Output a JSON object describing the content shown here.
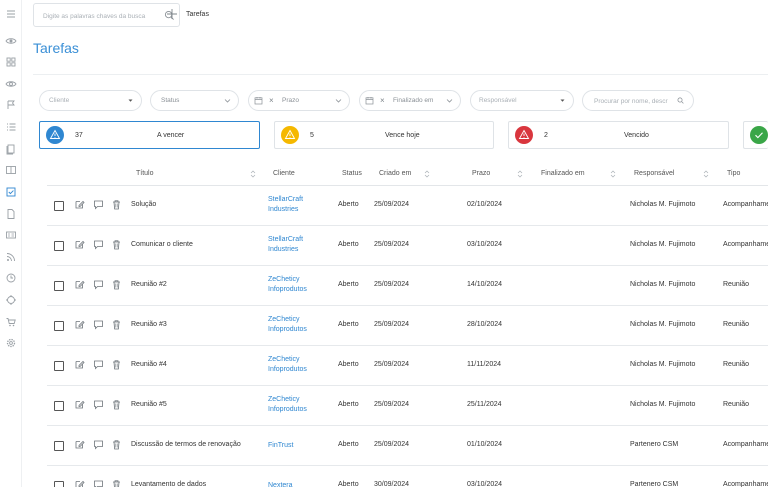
{
  "topbar": {
    "search_placeholder": "Digite as palavras chaves da busca",
    "breadcrumb": "Tarefas"
  },
  "page": {
    "title": "Tarefas"
  },
  "filters": {
    "cliente": "Cliente",
    "status": "Status",
    "prazo": "Prazo",
    "finalizado": "Finalizado em",
    "responsavel": "Responsável",
    "search_placeholder": "Procurar por nome, descr"
  },
  "cards": [
    {
      "count": "37",
      "label": "A vencer",
      "color": "#2f87d1",
      "icon": "warning-icon"
    },
    {
      "count": "5",
      "label": "Vence hoje",
      "color": "#f5b800",
      "icon": "warning-icon"
    },
    {
      "count": "2",
      "label": "Vencido",
      "color": "#d9363e",
      "icon": "warning-icon"
    },
    {
      "count": "",
      "label": "",
      "color": "#3aa648",
      "icon": "check-icon"
    }
  ],
  "columns": {
    "titulo": "Título",
    "cliente": "Cliente",
    "status": "Status",
    "criado": "Criado em",
    "prazo": "Prazo",
    "finalizado": "Finalizado em",
    "responsavel": "Responsável",
    "tipo": "Tipo"
  },
  "rows": [
    {
      "title": "Solução",
      "client_l1": "StellarCraft",
      "client_l2": "Industries",
      "status": "Aberto",
      "created": "25/09/2024",
      "due": "02/10/2024",
      "finished": "",
      "owner": "Nicholas M. Fujimoto",
      "type": "Acompanhame"
    },
    {
      "title": "Comunicar o cliente",
      "client_l1": "StellarCraft",
      "client_l2": "Industries",
      "status": "Aberto",
      "created": "25/09/2024",
      "due": "03/10/2024",
      "finished": "",
      "owner": "Nicholas M. Fujimoto",
      "type": "Acompanhame"
    },
    {
      "title": "Reunião #2",
      "client_l1": "ZeCheticy",
      "client_l2": "Infoprodutos",
      "status": "Aberto",
      "created": "25/09/2024",
      "due": "14/10/2024",
      "finished": "",
      "owner": "Nicholas M. Fujimoto",
      "type": "Reunião"
    },
    {
      "title": "Reunião #3",
      "client_l1": "ZeCheticy",
      "client_l2": "Infoprodutos",
      "status": "Aberto",
      "created": "25/09/2024",
      "due": "28/10/2024",
      "finished": "",
      "owner": "Nicholas M. Fujimoto",
      "type": "Reunião"
    },
    {
      "title": "Reunião #4",
      "client_l1": "ZeCheticy",
      "client_l2": "Infoprodutos",
      "status": "Aberto",
      "created": "25/09/2024",
      "due": "11/11/2024",
      "finished": "",
      "owner": "Nicholas M. Fujimoto",
      "type": "Reunião"
    },
    {
      "title": "Reunião #5",
      "client_l1": "ZeCheticy",
      "client_l2": "Infoprodutos",
      "status": "Aberto",
      "created": "25/09/2024",
      "due": "25/11/2024",
      "finished": "",
      "owner": "Nicholas M. Fujimoto",
      "type": "Reunião"
    },
    {
      "title": "Discussão de termos de renovação",
      "client_l1": "FinTrust",
      "client_l2": "",
      "status": "Aberto",
      "created": "25/09/2024",
      "due": "01/10/2024",
      "finished": "",
      "owner": "Partenero CSM",
      "type": "Acompanhame"
    },
    {
      "title": "Levantamento de dados",
      "client_l1": "Nextera Solutions",
      "client_l2": "",
      "status": "Aberto",
      "created": "30/09/2024",
      "due": "03/10/2024",
      "finished": "",
      "owner": "Partenero CSM",
      "type": "Acompanhame"
    }
  ],
  "sidebar_icons": [
    "menu-icon",
    "eye-icon",
    "grid-icon",
    "eye-closed-icon",
    "flag-icon",
    "list-icon",
    "document-stack-icon",
    "book-icon",
    "checkbox-icon",
    "file-icon",
    "id-card-icon",
    "rss-icon",
    "clock-icon",
    "target-icon",
    "cart-icon",
    "gear-icon"
  ]
}
